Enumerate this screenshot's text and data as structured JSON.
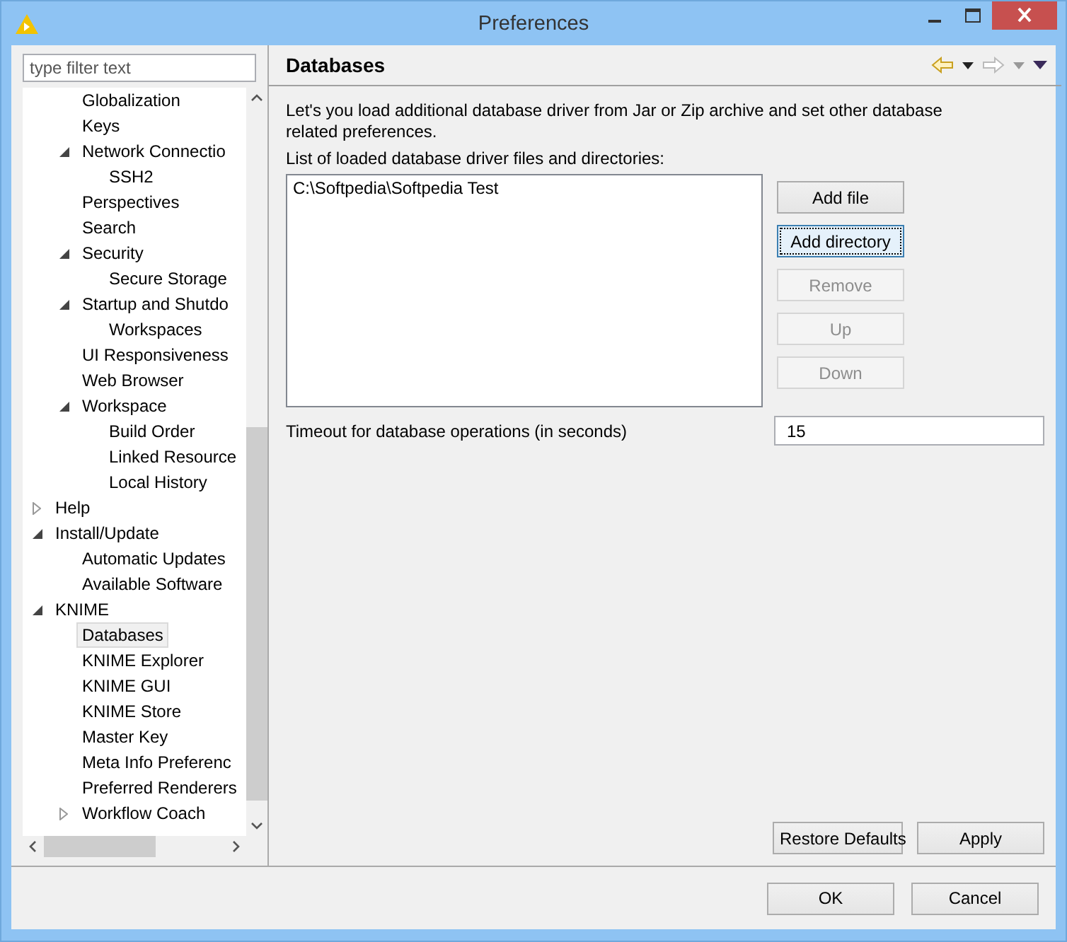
{
  "window": {
    "title": "Preferences"
  },
  "filter": {
    "placeholder": "type filter text"
  },
  "tree": [
    {
      "children": [
        {
          "label": "Globalization",
          "selected": false
        },
        {
          "label": "Keys",
          "selected": false
        },
        {
          "label": "Network Connectio",
          "selected": false,
          "expanded": true,
          "children": [
            {
              "label": "SSH2",
              "selected": false
            }
          ]
        },
        {
          "label": "Perspectives",
          "selected": false
        },
        {
          "label": "Search",
          "selected": false
        },
        {
          "label": "Security",
          "selected": false,
          "expanded": true,
          "children": [
            {
              "label": "Secure Storage",
              "selected": false
            }
          ]
        },
        {
          "label": "Startup and Shutdo",
          "selected": false,
          "expanded": true,
          "children": [
            {
              "label": "Workspaces",
              "selected": false
            }
          ]
        },
        {
          "label": "UI Responsiveness",
          "selected": false
        },
        {
          "label": "Web Browser",
          "selected": false
        },
        {
          "label": "Workspace",
          "selected": false,
          "expanded": true,
          "children": [
            {
              "label": "Build Order",
              "selected": false
            },
            {
              "label": "Linked Resource",
              "selected": false
            },
            {
              "label": "Local History",
              "selected": false
            }
          ]
        }
      ]
    },
    {
      "label": "Help",
      "selected": false,
      "expanded": false
    },
    {
      "label": "Install/Update",
      "selected": false,
      "expanded": true,
      "children": [
        {
          "label": "Automatic Updates",
          "selected": false
        },
        {
          "label": "Available Software",
          "selected": false
        }
      ]
    },
    {
      "label": "KNIME",
      "selected": false,
      "expanded": true,
      "children": [
        {
          "label": "Databases",
          "selected": true
        },
        {
          "label": "KNIME Explorer",
          "selected": false
        },
        {
          "label": "KNIME GUI",
          "selected": false
        },
        {
          "label": "KNIME Store",
          "selected": false
        },
        {
          "label": "Master Key",
          "selected": false
        },
        {
          "label": "Meta Info Preferenc",
          "selected": false
        },
        {
          "label": "Preferred Renderers",
          "selected": false
        },
        {
          "label": "Workflow Coach",
          "selected": false,
          "expanded": false
        }
      ]
    }
  ],
  "page": {
    "title": "Databases",
    "description": "Let's you load additional database driver from Jar or Zip archive and set other database related preferences.",
    "list_label": "List of loaded database driver files and directories:",
    "list_items": [
      "C:\\Softpedia\\Softpedia Test"
    ],
    "list_buttons": [
      {
        "label": "Add file",
        "disabled": false,
        "focused": false
      },
      {
        "label": "Add directory",
        "disabled": false,
        "focused": true
      },
      {
        "label": "Remove",
        "disabled": true,
        "focused": false
      },
      {
        "label": "Up",
        "disabled": true,
        "focused": false
      },
      {
        "label": "Down",
        "disabled": true,
        "focused": false
      }
    ],
    "timeout_label": "Timeout for database operations (in seconds)",
    "timeout_value": "15",
    "page_buttons": [
      "Restore Defaults",
      "Apply"
    ]
  },
  "buttons": [
    "OK",
    "Cancel"
  ]
}
